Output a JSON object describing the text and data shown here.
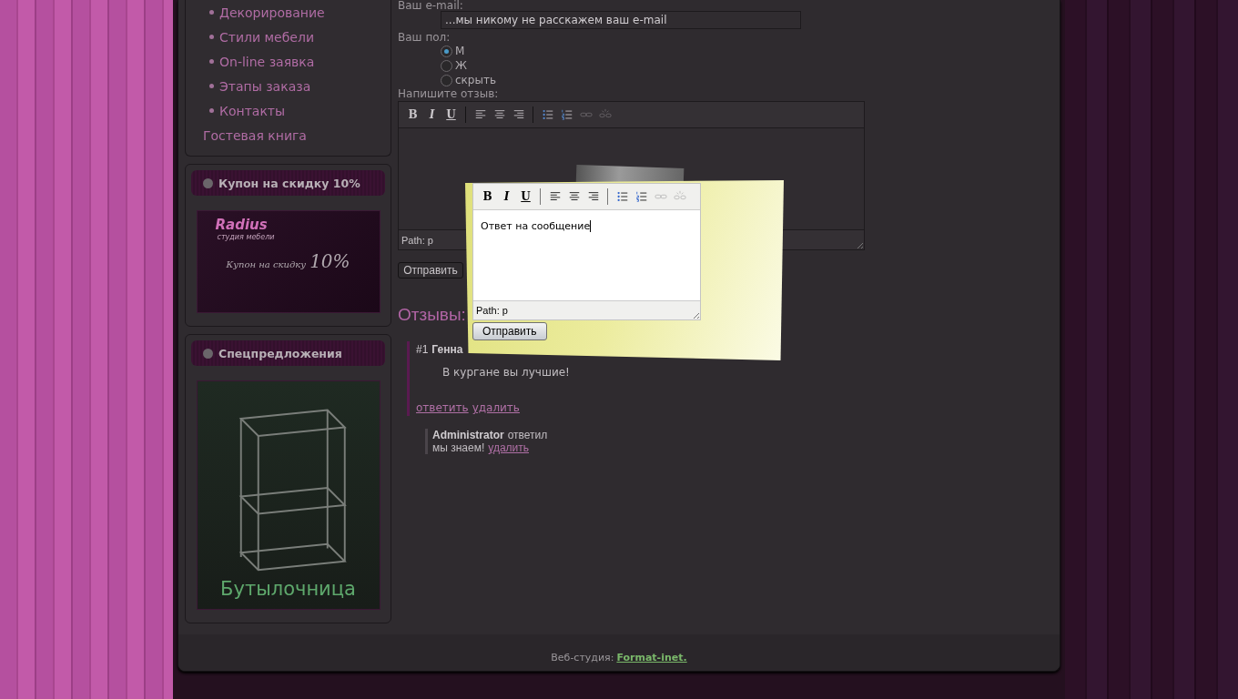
{
  "sidebar": {
    "menu": [
      {
        "label": "Декорирование",
        "bullet": true
      },
      {
        "label": "Стили мебели",
        "bullet": true
      },
      {
        "label": "On-line заявка",
        "bullet": true
      },
      {
        "label": "Этапы заказа",
        "bullet": true
      },
      {
        "label": "Контакты",
        "bullet": true
      },
      {
        "label": "Гостевая книга",
        "bullet": false
      }
    ],
    "blocks": [
      {
        "title": "Купон на скидку 10%",
        "kind": "coupon",
        "banner": {
          "brand": "Radius",
          "tagline": "студия мебели",
          "text": "Купон на скидку",
          "big": "10%"
        }
      },
      {
        "title": "Спецпредложения",
        "kind": "product",
        "banner": {
          "caption": "Бутылочница"
        }
      }
    ]
  },
  "form": {
    "email_label": "Ваш e-mail:",
    "email_value": "...мы никому не расскажем ваш e-mail",
    "gender_label": "Ваш пол:",
    "gender_options": [
      {
        "label": "М",
        "selected": true
      },
      {
        "label": "Ж",
        "selected": false
      },
      {
        "label": "скрыть",
        "selected": false
      }
    ],
    "review_label": "Напишите отзыв:",
    "editor": {
      "tools": [
        {
          "kind": "bold",
          "label": "B"
        },
        {
          "kind": "italic",
          "label": "I"
        },
        {
          "kind": "underline",
          "label": "U"
        },
        {
          "kind": "separator"
        },
        {
          "kind": "align-left"
        },
        {
          "kind": "align-center"
        },
        {
          "kind": "align-right"
        },
        {
          "kind": "separator"
        },
        {
          "kind": "bullet-list"
        },
        {
          "kind": "numbered-list"
        },
        {
          "kind": "link",
          "disabled": true
        },
        {
          "kind": "unlink",
          "disabled": true
        }
      ],
      "path": "Path: p"
    },
    "submit": "Отправить"
  },
  "reviews": {
    "title": "Отзывы:",
    "items": [
      {
        "number": "#1",
        "author": "Генна",
        "text": "В кургане вы лучшие!",
        "actions": [
          "ответить",
          "удалить"
        ],
        "replies": [
          {
            "author": "Administrator",
            "verb": "ответил",
            "text": "мы знаем!",
            "action": "удалить"
          }
        ]
      }
    ]
  },
  "dialog": {
    "editor": {
      "tools": [
        {
          "kind": "bold",
          "label": "B"
        },
        {
          "kind": "italic",
          "label": "I"
        },
        {
          "kind": "underline",
          "label": "U"
        },
        {
          "kind": "separator"
        },
        {
          "kind": "align-left"
        },
        {
          "kind": "align-center"
        },
        {
          "kind": "align-right"
        },
        {
          "kind": "separator"
        },
        {
          "kind": "bullet-list"
        },
        {
          "kind": "numbered-list"
        },
        {
          "kind": "link",
          "disabled": true
        },
        {
          "kind": "unlink",
          "disabled": true
        }
      ],
      "content": "Ответ на сообщение",
      "path": "Path: p"
    },
    "submit": "Отправить"
  },
  "footer": {
    "text": "Веб-студия:",
    "link": "Format-inet."
  }
}
